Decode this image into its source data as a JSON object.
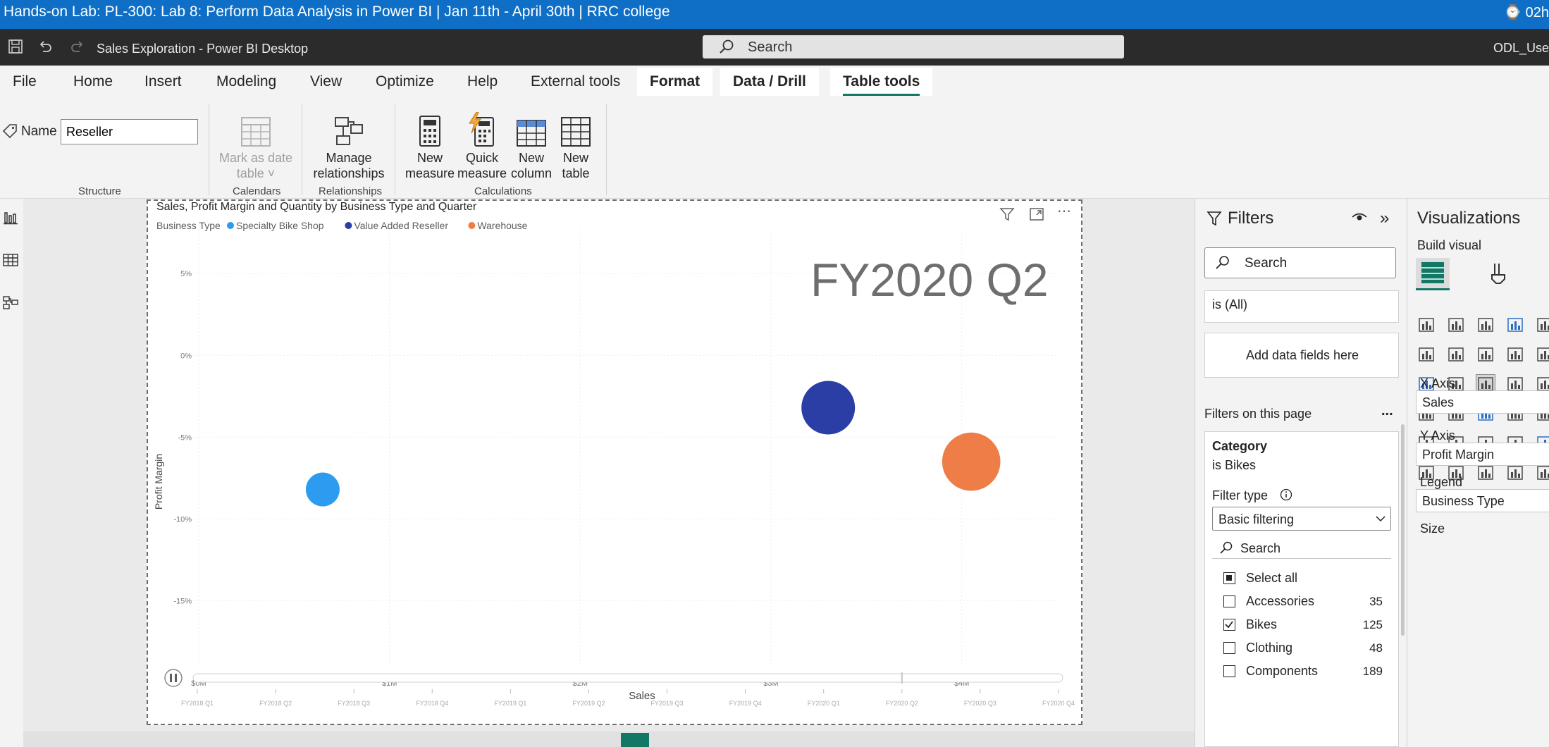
{
  "lab_banner": {
    "title": "Hands-on Lab: PL-300: Lab 8: Perform Data Analysis in Power BI | Jan 11th - April 30th | RRC college",
    "timer": "⌚ 02h"
  },
  "titlebar": {
    "document_title": "Sales Exploration - Power BI Desktop",
    "search_placeholder": "Search",
    "user": "ODL_Use"
  },
  "menu": {
    "tabs": [
      "File",
      "Home",
      "Insert",
      "Modeling",
      "View",
      "Optimize",
      "Help",
      "External tools"
    ],
    "context_tabs": [
      "Format",
      "Data / Drill",
      "Table tools"
    ],
    "active_tab": "Table tools"
  },
  "ribbon": {
    "name_label": "Name",
    "name_value": "Reseller",
    "mark_as_date_line1": "Mark as date",
    "mark_as_date_line2": "table ˅",
    "manage_line1": "Manage",
    "manage_line2": "relationships",
    "new_measure_line1": "New",
    "new_measure_line2": "measure",
    "quick_measure_line1": "Quick",
    "quick_measure_line2": "measure",
    "new_column_line1": "New",
    "new_column_line2": "column",
    "new_table_line1": "New",
    "new_table_line2": "table",
    "groups": {
      "structure": "Structure",
      "calendars": "Calendars",
      "relationships": "Relationships",
      "calculations": "Calculations"
    }
  },
  "visual": {
    "title": "Sales, Profit Margin and Quantity by Business Type and Quarter",
    "play_axis_label": "FY2020 Q2"
  },
  "chart_data": {
    "type": "scatter",
    "title": "Sales, Profit Margin and Quantity by Business Type and Quarter",
    "xlabel": "Sales",
    "ylabel": "Profit Margin",
    "legend_title": "Business Type",
    "legend_position": "top-left",
    "x_ticks": [
      "$0M",
      "$1M",
      "$2M",
      "$3M",
      "$4M"
    ],
    "x_range": [
      0,
      4.5
    ],
    "y_ticks": [
      "5%",
      "0%",
      "-5%",
      "-10%",
      "-15%"
    ],
    "y_range": [
      -18,
      6
    ],
    "grid": true,
    "series": [
      {
        "name": "Specialty Bike Shop",
        "color": "#2c9bf0",
        "points": [
          {
            "x": 0.65,
            "y": -8.2,
            "size": 1
          }
        ]
      },
      {
        "name": "Value Added Reseller",
        "color": "#2b3ea6",
        "points": [
          {
            "x": 3.3,
            "y": -3.2,
            "size": 4
          }
        ]
      },
      {
        "name": "Warehouse",
        "color": "#ef7d47",
        "points": [
          {
            "x": 4.05,
            "y": -6.5,
            "size": 5
          }
        ]
      }
    ],
    "play_axis_ticks": [
      "FY2018 Q1",
      "FY2018 Q2",
      "FY2018 Q3",
      "FY2018 Q4",
      "FY2019 Q1",
      "FY2019 Q2",
      "FY2019 Q3",
      "FY2019 Q4",
      "FY2020 Q1",
      "FY2020 Q2",
      "FY2020 Q3",
      "FY2020 Q4"
    ],
    "play_axis_current": "FY2020 Q2"
  },
  "filters": {
    "header": "Filters",
    "search_placeholder": "Search",
    "prev_card_value": "is (All)",
    "add_fields": "Add data fields here",
    "page_section": "Filters on this page",
    "page_section_more": "...",
    "category_card": {
      "name": "Category",
      "state": "is Bikes",
      "filter_type_label": "Filter type",
      "filter_type_value": "Basic filtering",
      "search_placeholder": "Search",
      "select_all": "Select all",
      "items": [
        {
          "label": "Accessories",
          "count": "35",
          "checked": false
        },
        {
          "label": "Bikes",
          "count": "125",
          "checked": true
        },
        {
          "label": "Clothing",
          "count": "48",
          "checked": false
        },
        {
          "label": "Components",
          "count": "189",
          "checked": false
        }
      ]
    }
  },
  "visualizations": {
    "header": "Visualizations",
    "build_visual": "Build visual",
    "wells": {
      "x_axis_label": "X Axis",
      "x_axis_value": "Sales",
      "y_axis_label": "Y Axis",
      "y_axis_value": "Profit Margin",
      "legend_label": "Legend",
      "legend_value": "Business Type",
      "size_label": "Size"
    }
  }
}
